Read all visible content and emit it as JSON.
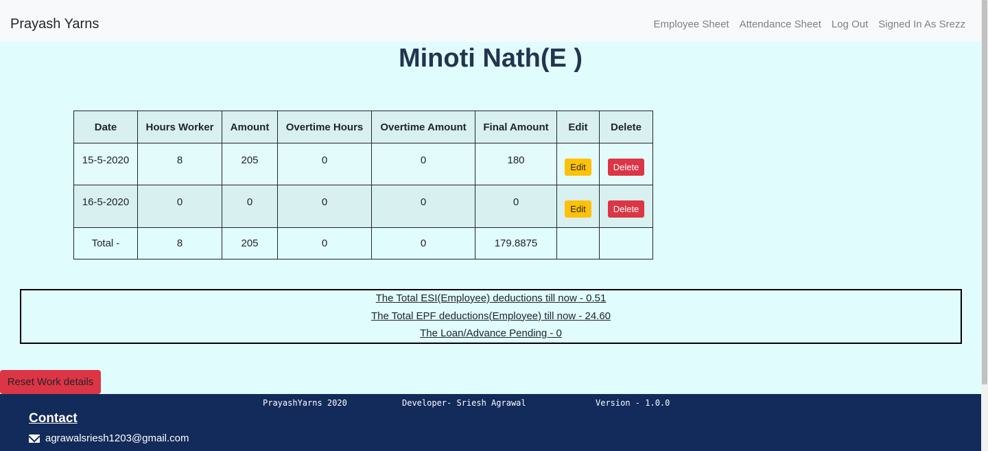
{
  "navbar": {
    "brand": "Prayash Yarns",
    "links": [
      "Employee Sheet",
      "Attendance Sheet",
      "Log Out",
      "Signed In As Srezz"
    ]
  },
  "page_title": "Minoti Nath(E )",
  "table": {
    "headers": [
      "Date",
      "Hours Worker",
      "Amount",
      "Overtime Hours",
      "Overtime Amount",
      "Final Amount",
      "Edit",
      "Delete"
    ],
    "rows": [
      {
        "date": "15-5-2020",
        "hours": "8",
        "amount": "205",
        "ot_hours": "0",
        "ot_amount": "0",
        "final": "180",
        "edit": "Edit",
        "delete": "Delete"
      },
      {
        "date": "16-5-2020",
        "hours": "0",
        "amount": "0",
        "ot_hours": "0",
        "ot_amount": "0",
        "final": "0",
        "edit": "Edit",
        "delete": "Delete"
      }
    ],
    "total": {
      "label": "Total -",
      "hours": "8",
      "amount": "205",
      "ot_hours": "0",
      "ot_amount": "0",
      "final": "179.8875"
    }
  },
  "deductions": [
    "The Total ESI(Employee) deductions till now - 0.51",
    "The Total EPF deductions(Employee) till now - 24.60",
    "The Loan/Advance Pending - 0"
  ],
  "reset_button": "Reset Work details",
  "footer": {
    "company": "PrayashYarns 2020",
    "developer": "Developer- Sriesh Agrawal",
    "version": "Version - 1.0.0",
    "contact_title": "Contact",
    "email": "agrawalsriesh1203@gmail.com",
    "email_icon": "envelope-icon"
  },
  "colors": {
    "background": "#e0fcfd",
    "footer": "#122b5a",
    "edit": "#ffc107",
    "delete": "#dc3545",
    "title": "#24344f"
  }
}
